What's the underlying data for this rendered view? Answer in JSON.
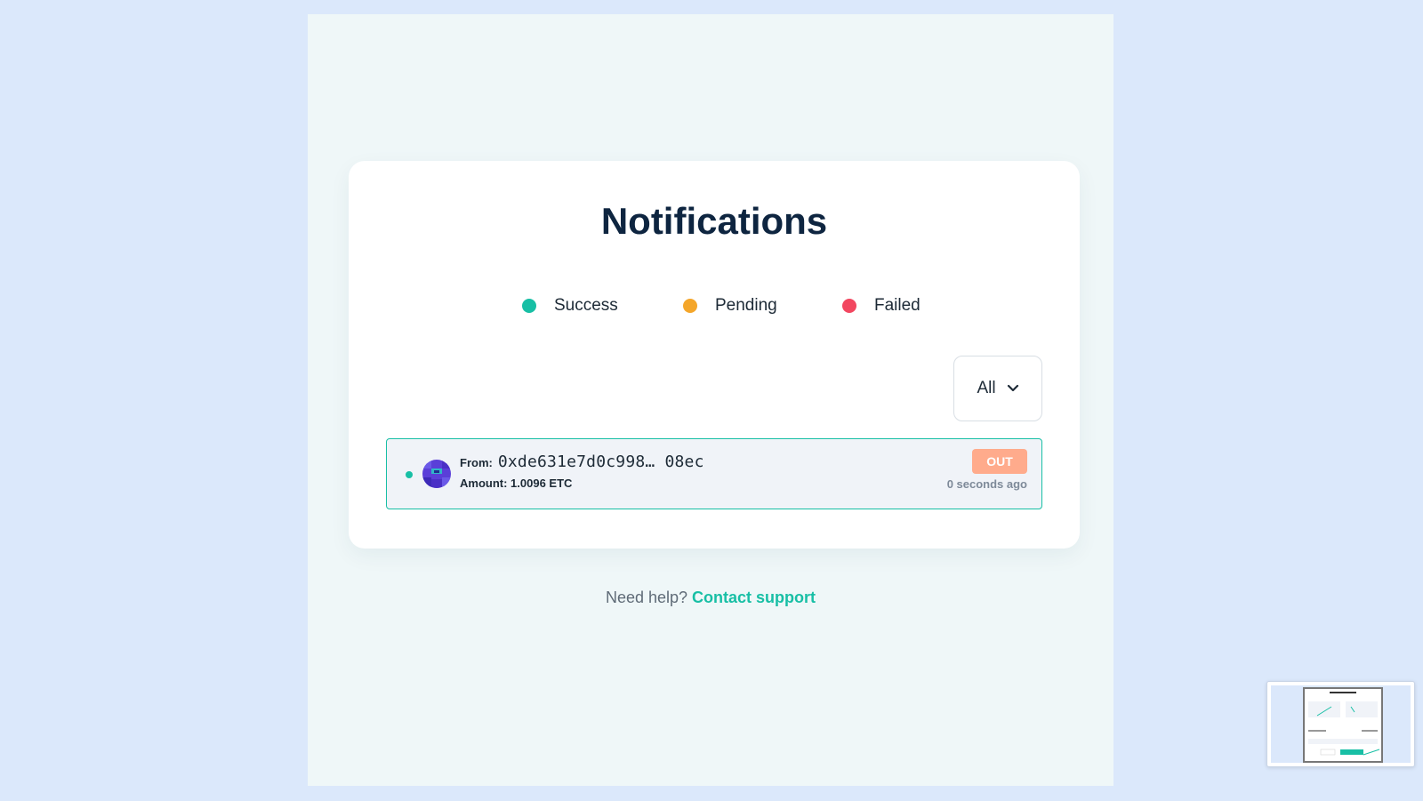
{
  "title": "Notifications",
  "legend": [
    {
      "label": "Success",
      "color": "#18bfa5"
    },
    {
      "label": "Pending",
      "color": "#f4a62a"
    },
    {
      "label": "Failed",
      "color": "#f24760"
    }
  ],
  "filter": {
    "selected": "All",
    "icon": "chevron-down-icon"
  },
  "notification": {
    "status_color": "#18bfa5",
    "from_label": "From:",
    "from_address": "0xde631e7d0c998… 08ec",
    "amount_label": "Amount: 1.0096 ETC",
    "direction": "OUT",
    "time": "0 seconds ago"
  },
  "help": {
    "text": "Need help?",
    "link": "Contact support"
  }
}
